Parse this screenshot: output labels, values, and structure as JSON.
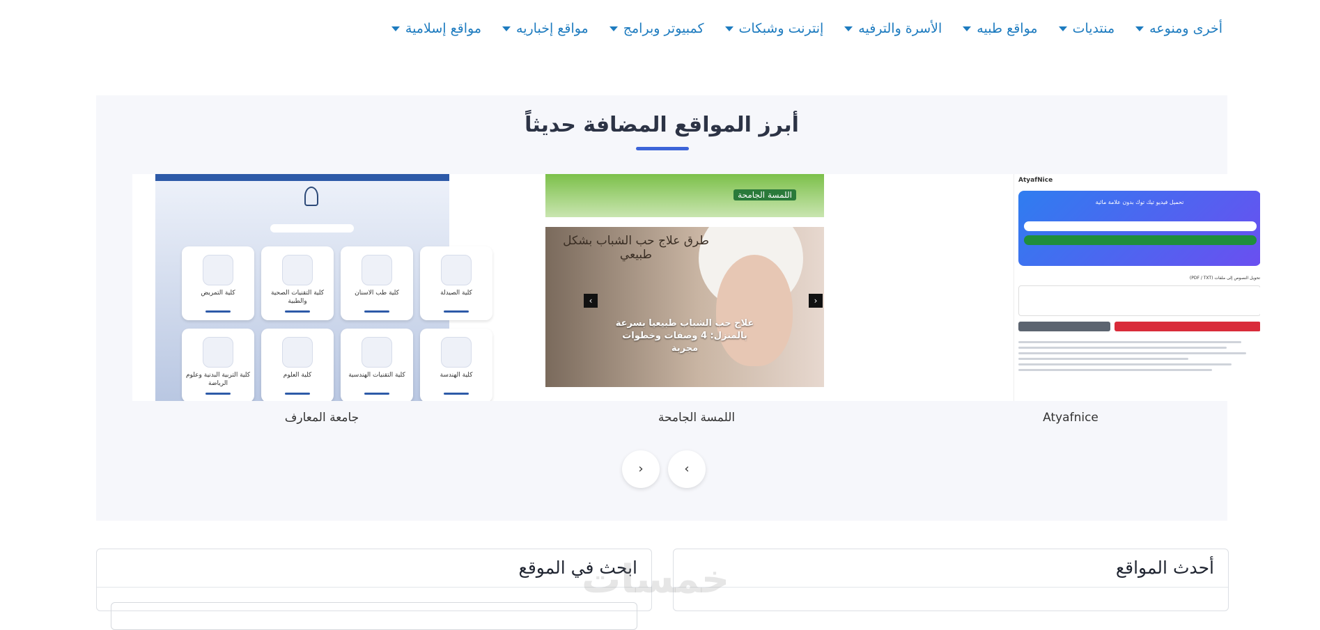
{
  "nav": {
    "items": [
      {
        "label": "مواقع إسلامية"
      },
      {
        "label": "مواقع إخباريه"
      },
      {
        "label": "كمبيوتر وبرامج"
      },
      {
        "label": "إنترنت وشبكات"
      },
      {
        "label": "الأسرة والترفيه"
      },
      {
        "label": "مواقع طبيه"
      },
      {
        "label": "منتديات"
      },
      {
        "label": "أخرى ومنوعه"
      }
    ]
  },
  "featured": {
    "title": "أبرز المواقع المضافة حديثاً",
    "cards": [
      {
        "label": "Atyafnice",
        "thumb": {
          "brand": "AtyafNice",
          "hero_title": "تحميل فيديو تيك توك بدون علامة مائية",
          "subheading": "تحويل النصوص إلى ملفات (PDF / TXT)"
        }
      },
      {
        "label": "اللمسة الجامحة",
        "thumb": {
          "banner_title": "اللمسة الجامحة",
          "top_text": "طرق علاج حب الشباب بشكل طبيعي",
          "overlay_text": "علاج حب الشباب طبيعيا بسرعة بالمنزل: 4 وصفات وخطوات مجربة"
        }
      },
      {
        "label": "جامعة المعارف",
        "thumb": {
          "tiles": [
            "كلية التمريض",
            "كلية التقنيات الصحية والطبية",
            "كلية طب الاسنان",
            "كلية الصيدلة",
            "كلية التربية البدنية وعلوم الرياضة",
            "كلية العلوم",
            "كلية التقنيات الهندسية",
            "كلية الهندسة"
          ]
        }
      }
    ],
    "prev_glyph": "‹",
    "next_glyph": "›"
  },
  "panels": {
    "latest_title": "أحدث المواقع",
    "search_title": "ابحث في الموقع"
  },
  "watermark": "خمسات"
}
